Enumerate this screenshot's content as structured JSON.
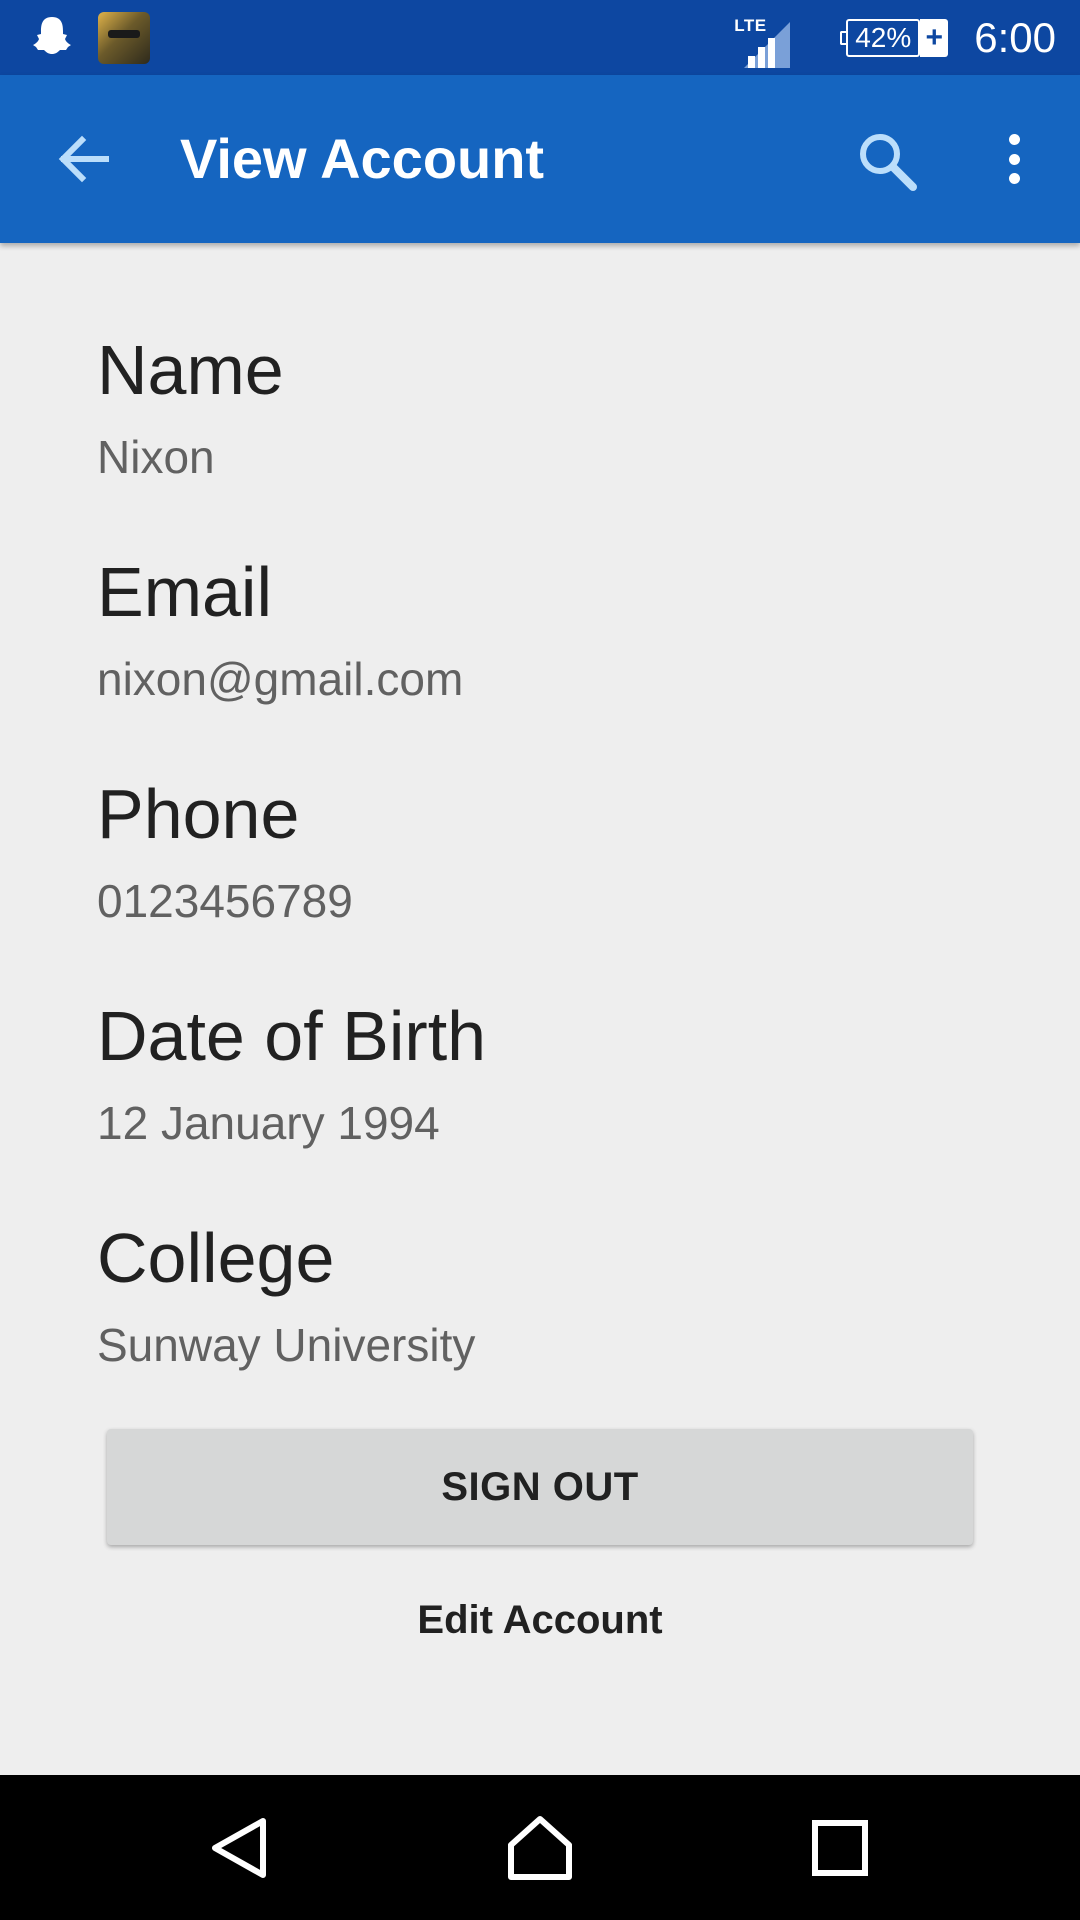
{
  "status_bar": {
    "network": "LTE",
    "battery": "42%",
    "time": "6:00",
    "icons": [
      "snapchat-icon",
      "app-notification-icon",
      "signal-icon",
      "battery-charging-icon"
    ]
  },
  "app_bar": {
    "title": "View Account",
    "icons": [
      "back-arrow-icon",
      "search-icon",
      "more-vert-icon"
    ]
  },
  "account": {
    "fields": [
      {
        "label": "Name",
        "value": "Nixon"
      },
      {
        "label": "Email",
        "value": "nixon@gmail.com"
      },
      {
        "label": "Phone",
        "value": "0123456789"
      },
      {
        "label": "Date of Birth",
        "value": "12 January 1994"
      },
      {
        "label": "College",
        "value": "Sunway University"
      }
    ]
  },
  "actions": {
    "sign_out": "SIGN OUT",
    "edit_account": "Edit Account"
  },
  "nav_bar": {
    "icons": [
      "nav-back-icon",
      "nav-home-icon",
      "nav-recents-icon"
    ]
  },
  "colors": {
    "status_bar": "#0d47a1",
    "app_bar": "#1565c0",
    "background": "#eeeeee",
    "button": "#d6d7d7"
  }
}
